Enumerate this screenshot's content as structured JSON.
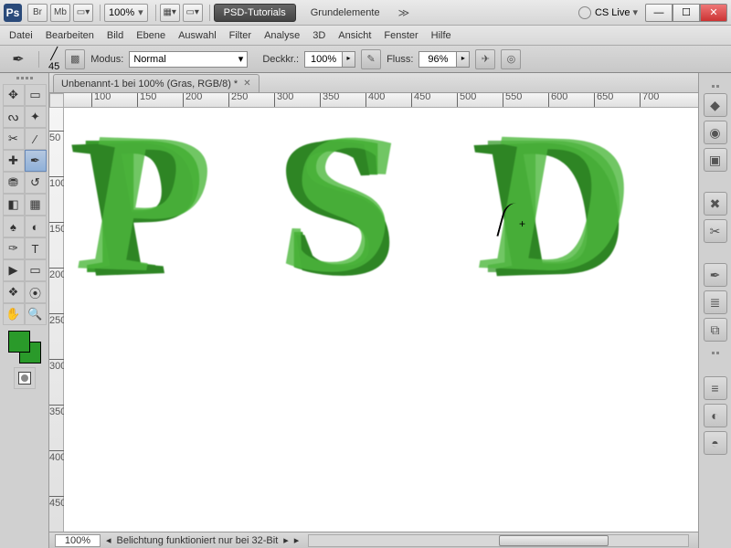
{
  "titlebar": {
    "app_abbr": "Ps",
    "br": "Br",
    "mb": "Mb",
    "zoom": "100%",
    "workspace_primary": "PSD-Tutorials",
    "workspace_secondary": "Grundelemente",
    "cslive": "CS Live"
  },
  "menu": {
    "datei": "Datei",
    "bearbeiten": "Bearbeiten",
    "bild": "Bild",
    "ebene": "Ebene",
    "auswahl": "Auswahl",
    "filter": "Filter",
    "analyse": "Analyse",
    "dreid": "3D",
    "ansicht": "Ansicht",
    "fenster": "Fenster",
    "hilfe": "Hilfe"
  },
  "options": {
    "brush_size": "45",
    "modus_label": "Modus:",
    "modus_value": "Normal",
    "opacity_label": "Deckkr.:",
    "opacity_value": "100%",
    "flow_label": "Fluss:",
    "flow_value": "96%"
  },
  "document": {
    "tab_title": "Unbenannt-1 bei 100% (Gras, RGB/8) *",
    "status_zoom": "100%",
    "status_text": "Belichtung funktioniert nur bei 32-Bit"
  },
  "ruler_h": [
    "100",
    "150",
    "200",
    "250",
    "300",
    "350",
    "400",
    "450",
    "500",
    "550",
    "600",
    "650",
    "700"
  ],
  "ruler_v": [
    "50",
    "100",
    "150",
    "200",
    "250",
    "300",
    "350",
    "400",
    "450"
  ],
  "colors": {
    "foreground": "#2a9a2a",
    "background": "#2a9a2a"
  },
  "canvas_text": {
    "p": "P",
    "s": "S",
    "d": "D"
  }
}
